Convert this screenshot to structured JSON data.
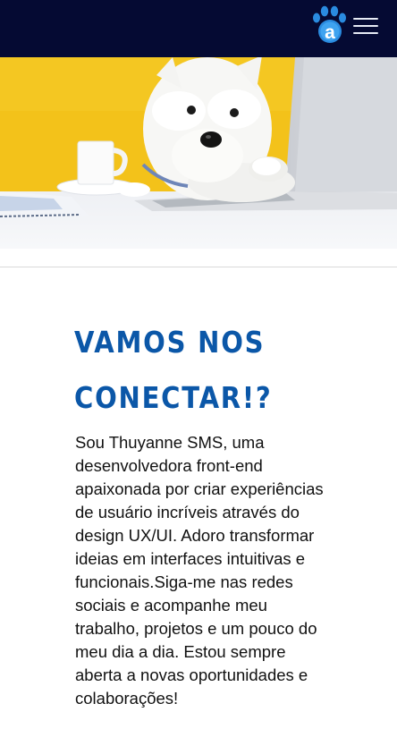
{
  "header": {
    "logo_icon": "paw-a-logo-icon",
    "menu_icon": "hamburger-menu-icon",
    "background": "#050a33"
  },
  "hero": {
    "image": "white-terrier-dog-looking-at-laptop-with-coffee-cup-on-yellow-background"
  },
  "section": {
    "title": "VAMOS NOS CONECTAR!?",
    "text": "Sou Thuyanne SMS, uma desenvolvedora front-end apaixonada por criar experiências de usuário incríveis através do design UX/UI. Adoro transformar ideias em interfaces intuitivas e funcionais.Siga-me nas redes sociais e acompanhe meu trabalho, projetos e um pouco do meu dia a dia. Estou sempre aberta a novas oportunidades e colaborações!"
  },
  "colors": {
    "title": "#0b57a8",
    "hero_bg": "#f2c21c",
    "text": "#111111"
  }
}
